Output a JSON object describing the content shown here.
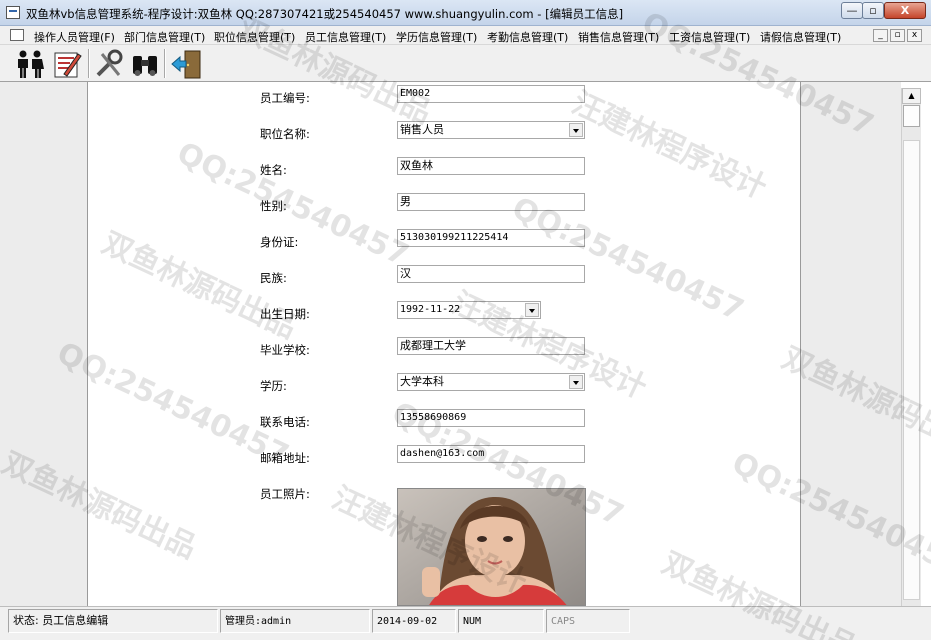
{
  "window": {
    "title": "双鱼林vb信息管理系统-程序设计:双鱼林 QQ:287307421或254540457 www.shuangyulin.com - [编辑员工信息]",
    "min_symbol": "—",
    "max_symbol": "▫",
    "close_symbol": "X"
  },
  "menu": {
    "items": [
      {
        "label": "操作人员管理(F)"
      },
      {
        "label": "部门信息管理(T)"
      },
      {
        "label": "职位信息管理(T)"
      },
      {
        "label": "员工信息管理(T)"
      },
      {
        "label": "学历信息管理(T)"
      },
      {
        "label": "考勤信息管理(T)"
      },
      {
        "label": "销售信息管理(T)"
      },
      {
        "label": "工资信息管理(T)"
      },
      {
        "label": "请假信息管理(T)"
      }
    ],
    "mdi_min": "_",
    "mdi_restore": "▫",
    "mdi_close": "x"
  },
  "toolbar": {
    "icons": [
      "people-icon",
      "edit-document-icon",
      "tools-icon",
      "binoculars-icon",
      "exit-door-icon"
    ]
  },
  "form": {
    "fields": [
      {
        "label": "员工编号:",
        "value": "EM002",
        "kind": "text"
      },
      {
        "label": "职位名称:",
        "value": "销售人员",
        "kind": "combo"
      },
      {
        "label": "姓名:",
        "value": "双鱼林",
        "kind": "text"
      },
      {
        "label": "性别:",
        "value": "男",
        "kind": "text"
      },
      {
        "label": "身份证:",
        "value": "513030199211225414",
        "kind": "text"
      },
      {
        "label": "民族:",
        "value": "汉",
        "kind": "text"
      },
      {
        "label": "出生日期:",
        "value": "1992-11-22",
        "kind": "date"
      },
      {
        "label": "毕业学校:",
        "value": "成都理工大学",
        "kind": "text"
      },
      {
        "label": "学历:",
        "value": "大学本科",
        "kind": "combo"
      },
      {
        "label": "联系电话:",
        "value": "13558690869",
        "kind": "text"
      },
      {
        "label": "邮箱地址:",
        "value": "dashen@163.com",
        "kind": "text"
      }
    ],
    "photo_label": "员工照片:"
  },
  "statusbar": {
    "status": "状态:  员工信息编辑",
    "admin": "管理员:admin",
    "date": "2014-09-02",
    "num": "NUM",
    "caps": "CAPS"
  },
  "watermark": {
    "texts": [
      "汪建林程序设计",
      "双鱼林源码出品",
      "QQ:254540457"
    ]
  },
  "colors": {
    "skin": "#e9c0a4",
    "hair": "#6b4a32",
    "dress": "#d63b3b"
  }
}
